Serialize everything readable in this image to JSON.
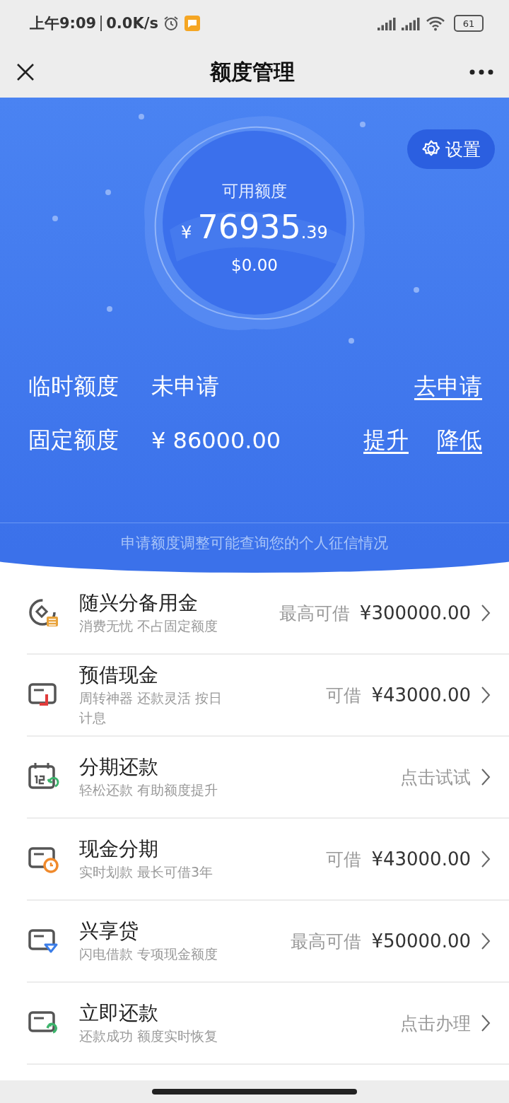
{
  "status_bar": {
    "time": "上午9:09",
    "speed": "0.0K/s",
    "battery": "61"
  },
  "nav": {
    "title": "额度管理"
  },
  "summary": {
    "settings": "设置",
    "available_label": "可用额度",
    "currency": "¥",
    "amount_int": "76935",
    "amount_dec": ".39",
    "usd": "$0.00"
  },
  "limits": [
    {
      "label": "临时额度",
      "value": "未申请",
      "actions": [
        "去申请"
      ]
    },
    {
      "label": "固定额度",
      "value": "¥ 86000.00",
      "actions": [
        "提升",
        "降低"
      ]
    }
  ],
  "notice": "申请额度调整可能查询您的个人征信情况",
  "products": [
    {
      "kind": "reserve",
      "title": "随兴分备用金",
      "subtitle": "消费无忧 不占固定额度",
      "label": "最高可借",
      "amount": "¥300000.00"
    },
    {
      "kind": "cash",
      "title": "预借现金",
      "subtitle": "周转神器 还款灵活 按日计息",
      "label": "可借",
      "amount": "¥43000.00"
    },
    {
      "kind": "installment",
      "title": "分期还款",
      "subtitle": "轻松还款 有助额度提升",
      "action": "点击试试"
    },
    {
      "kind": "cash-installment",
      "title": "现金分期",
      "subtitle": "实时划款 最长可借3年",
      "label": "可借",
      "amount": "¥43000.00"
    },
    {
      "kind": "loan",
      "title": "兴享贷",
      "subtitle": "闪电借款 专项现金额度",
      "label": "最高可借",
      "amount": "¥50000.00"
    },
    {
      "kind": "repay",
      "title": "立即还款",
      "subtitle": "还款成功 额度实时恢复",
      "action": "点击办理"
    }
  ]
}
